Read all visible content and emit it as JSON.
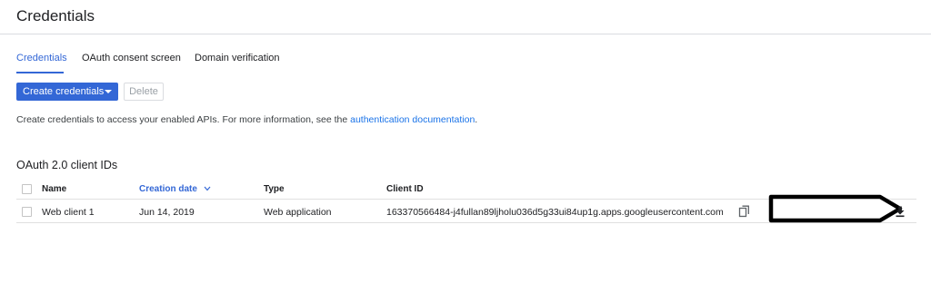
{
  "header": {
    "title": "Credentials"
  },
  "tabs": [
    {
      "label": "Credentials",
      "active": true
    },
    {
      "label": "OAuth consent screen",
      "active": false
    },
    {
      "label": "Domain verification",
      "active": false
    }
  ],
  "toolbar": {
    "create_label": "Create credentials",
    "delete_label": "Delete"
  },
  "info": {
    "text": "Create credentials to access your enabled APIs. For more information, see the ",
    "link_text": "authentication documentation",
    "suffix": "."
  },
  "section": {
    "title": "OAuth 2.0 client IDs"
  },
  "table": {
    "columns": {
      "name": "Name",
      "creation_date": "Creation date",
      "type": "Type",
      "client_id": "Client ID"
    },
    "rows": [
      {
        "name": "Web client 1",
        "creation_date": "Jun 14, 2019",
        "type": "Web application",
        "client_id": "163370566484-j4fullan89ljholu036d5g33ui84up1g.apps.googleusercontent.com"
      }
    ]
  },
  "icons": {
    "sort": "chevron-down-icon",
    "copy": "copy-icon",
    "download": "download-icon",
    "dropdown": "caret-down-icon"
  },
  "colors": {
    "accent": "#3367d6",
    "link": "#1a73e8",
    "divider": "#dadce0"
  }
}
